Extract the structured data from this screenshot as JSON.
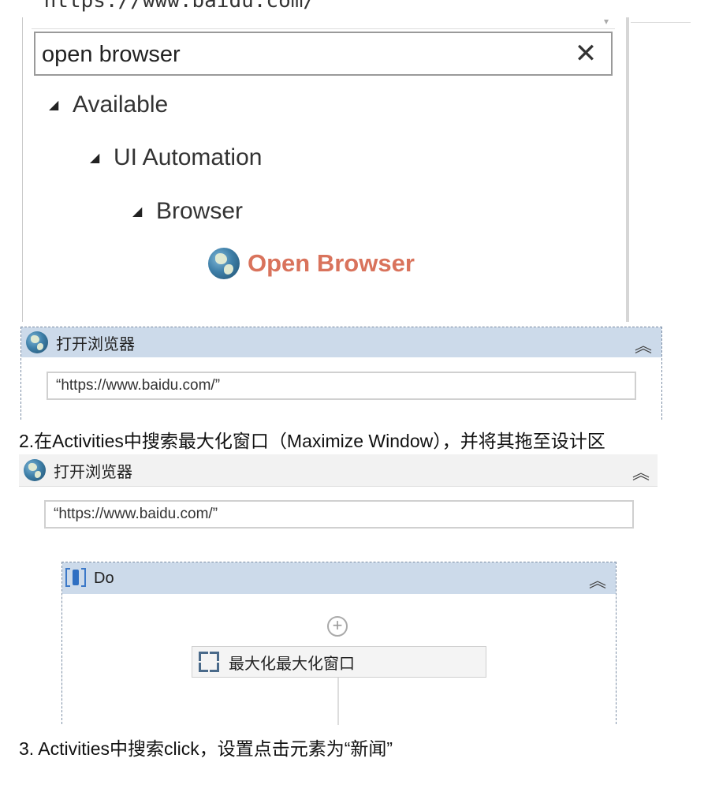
{
  "top_url_fragment": "“https://www.baidu.com/”",
  "search": {
    "value": "open browser",
    "clear_icon": "close-icon"
  },
  "tree": {
    "available": "Available",
    "ui_automation": "UI Automation",
    "browser": "Browser",
    "open_browser": "Open Browser"
  },
  "card1": {
    "title": "打开浏览器",
    "url": "“https://www.baidu.com/”",
    "collapse_glyph": "≈"
  },
  "step2_text": "2.在Activities中搜索最大化窗口（Maximize Window），并将其拖至设计区",
  "card2": {
    "title": "打开浏览器",
    "url": "“https://www.baidu.com/”",
    "do": {
      "title": "Do",
      "activity_label": "最大化最大化窗口"
    }
  },
  "step3_text": "3. Activities中搜索click，设置点击元素为“新闻”",
  "colors": {
    "header_blue": "#ccdaea",
    "open_browser_text": "#d9735c"
  }
}
